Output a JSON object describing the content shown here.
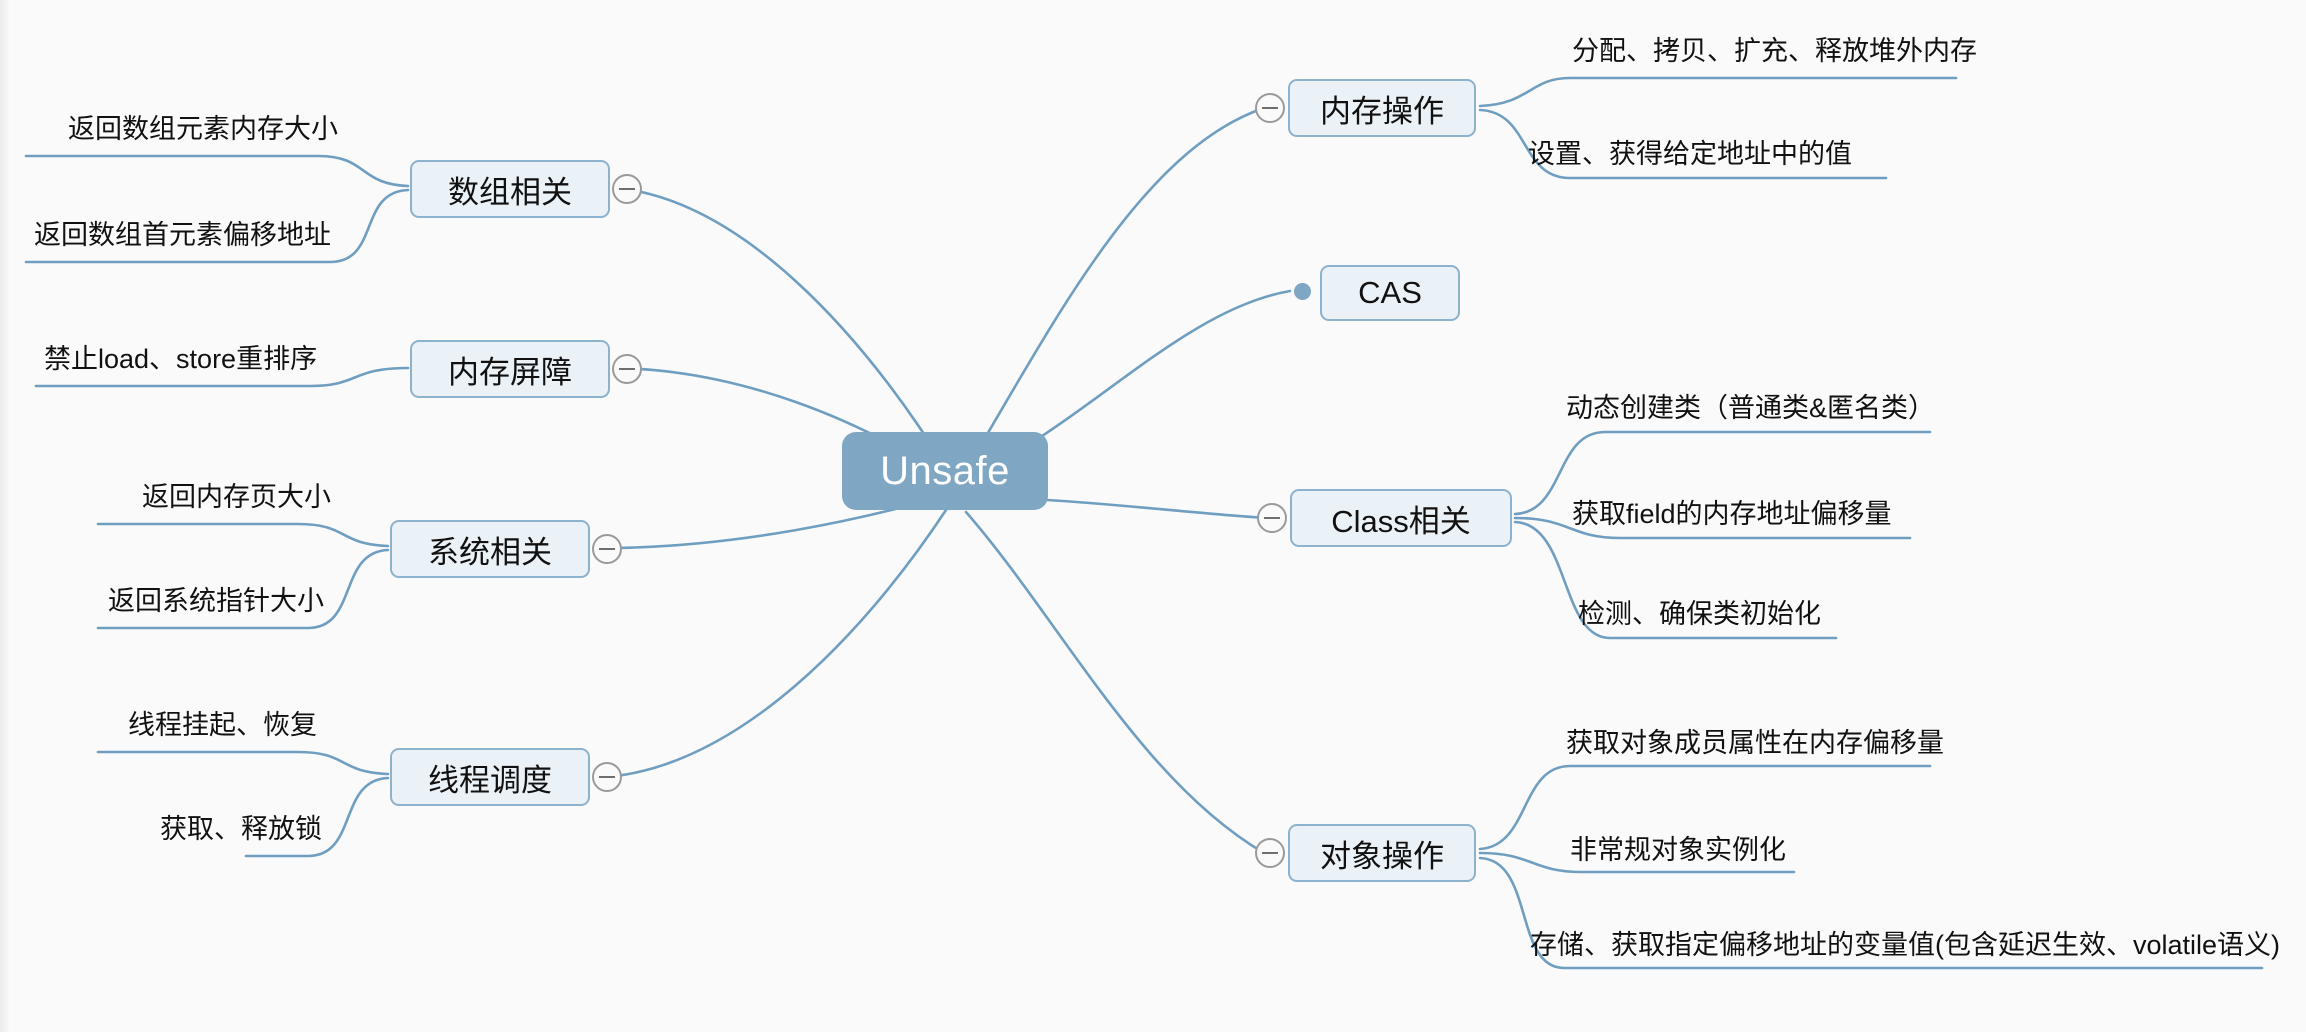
{
  "diagram": {
    "type": "mind-map",
    "title": "Unsafe",
    "background_color": "#fafafa",
    "root": {
      "label": "Unsafe",
      "fill": "#7fa6c2",
      "text_color": "#ffffff"
    },
    "branch_style": {
      "fill": "#eaf1f7",
      "border": "#8db2cd",
      "text_color": "#111111",
      "connector": "#6f9ec0"
    },
    "branches": [
      {
        "id": "memory-ops",
        "label": "内存操作",
        "side": "right",
        "toggle": "collapse-minus",
        "children": [
          {
            "label": "分配、拷贝、扩充、释放堆外内存"
          },
          {
            "label": "设置、获得给定地址中的值"
          }
        ]
      },
      {
        "id": "cas",
        "label": "CAS",
        "side": "right",
        "toggle": "leaf-dot",
        "children": []
      },
      {
        "id": "class-related",
        "label": "Class相关",
        "side": "right",
        "toggle": "collapse-minus",
        "children": [
          {
            "label": "动态创建类（普通类&匿名类）"
          },
          {
            "label": "获取field的内存地址偏移量"
          },
          {
            "label": "检测、确保类初始化"
          }
        ]
      },
      {
        "id": "object-ops",
        "label": "对象操作",
        "side": "right",
        "toggle": "collapse-minus",
        "children": [
          {
            "label": "获取对象成员属性在内存偏移量"
          },
          {
            "label": "非常规对象实例化"
          },
          {
            "label": "存储、获取指定偏移地址的变量值(包含延迟生效、volatile语义)"
          }
        ]
      },
      {
        "id": "array-related",
        "label": "数组相关",
        "side": "left",
        "toggle": "collapse-minus",
        "children": [
          {
            "label": "返回数组元素内存大小"
          },
          {
            "label": "返回数组首元素偏移地址"
          }
        ]
      },
      {
        "id": "memory-barrier",
        "label": "内存屏障",
        "side": "left",
        "toggle": "collapse-minus",
        "children": [
          {
            "label": "禁止load、store重排序"
          }
        ]
      },
      {
        "id": "system-related",
        "label": "系统相关",
        "side": "left",
        "toggle": "collapse-minus",
        "children": [
          {
            "label": "返回内存页大小"
          },
          {
            "label": "返回系统指针大小"
          }
        ]
      },
      {
        "id": "thread-scheduling",
        "label": "线程调度",
        "side": "left",
        "toggle": "collapse-minus",
        "children": [
          {
            "label": "线程挂起、恢复"
          },
          {
            "label": "获取、释放锁"
          }
        ]
      }
    ]
  }
}
